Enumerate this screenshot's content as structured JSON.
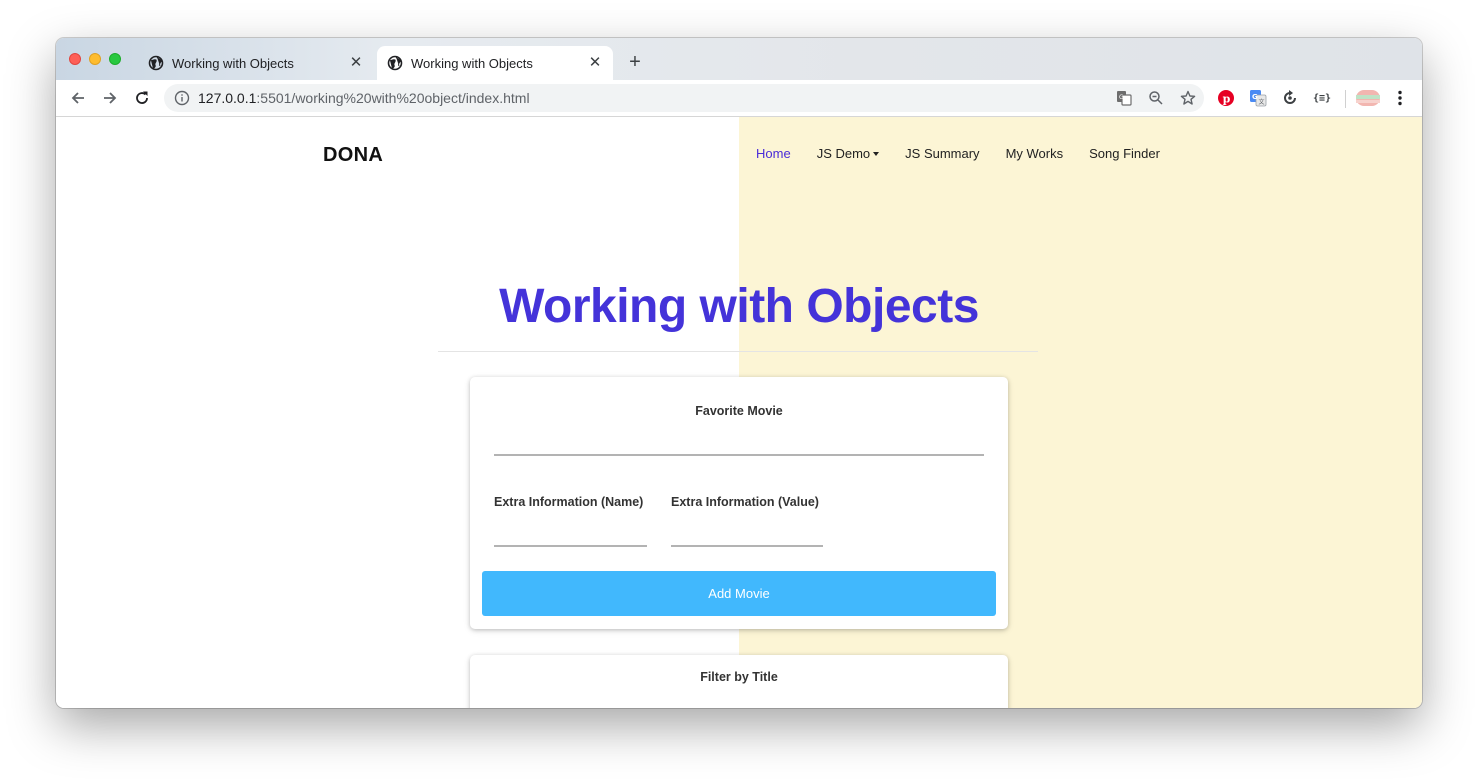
{
  "browser": {
    "tabs": [
      {
        "title": "Working with Objects",
        "close": "✕"
      },
      {
        "title": "Working with Objects",
        "close": "✕"
      }
    ],
    "new_tab": "+",
    "url_host": "127.0.0.1",
    "url_rest": ":5501/working%20with%20object/index.html",
    "icons": {
      "back": "arrow-left-icon",
      "forward": "arrow-right-icon",
      "reload": "reload-icon",
      "info": "info-icon",
      "translate": "translate-icon",
      "zoom": "zoom-out-icon",
      "bookmark": "star-icon",
      "menu": "kebab-menu-icon"
    },
    "extensions": [
      "pinterest-icon",
      "google-translate-icon",
      "sync-icon",
      "json-viewer-icon",
      "profile-avatar-icon"
    ],
    "extension_json_label": "{≡}",
    "accent": "#fe5f57"
  },
  "page": {
    "brand": "DONA",
    "nav": [
      {
        "label": "Home",
        "active": true
      },
      {
        "label": "JS Demo",
        "dropdown": true
      },
      {
        "label": "JS Summary"
      },
      {
        "label": "My Works"
      },
      {
        "label": "Song Finder"
      }
    ],
    "title": "Working with Objects",
    "form": {
      "movie_label": "Favorite Movie",
      "movie_value": "",
      "extra_name_label": "Extra Information (Name)",
      "extra_name_value": "",
      "extra_value_label": "Extra Information (Value)",
      "extra_value_value": "",
      "submit_label": "Add Movie"
    },
    "filter": {
      "label": "Filter by Title"
    },
    "colors": {
      "title": "#4433d9",
      "nav_active": "#4a2bd8",
      "button": "#41b8fd",
      "right_panel": "#fcf5d5"
    }
  }
}
